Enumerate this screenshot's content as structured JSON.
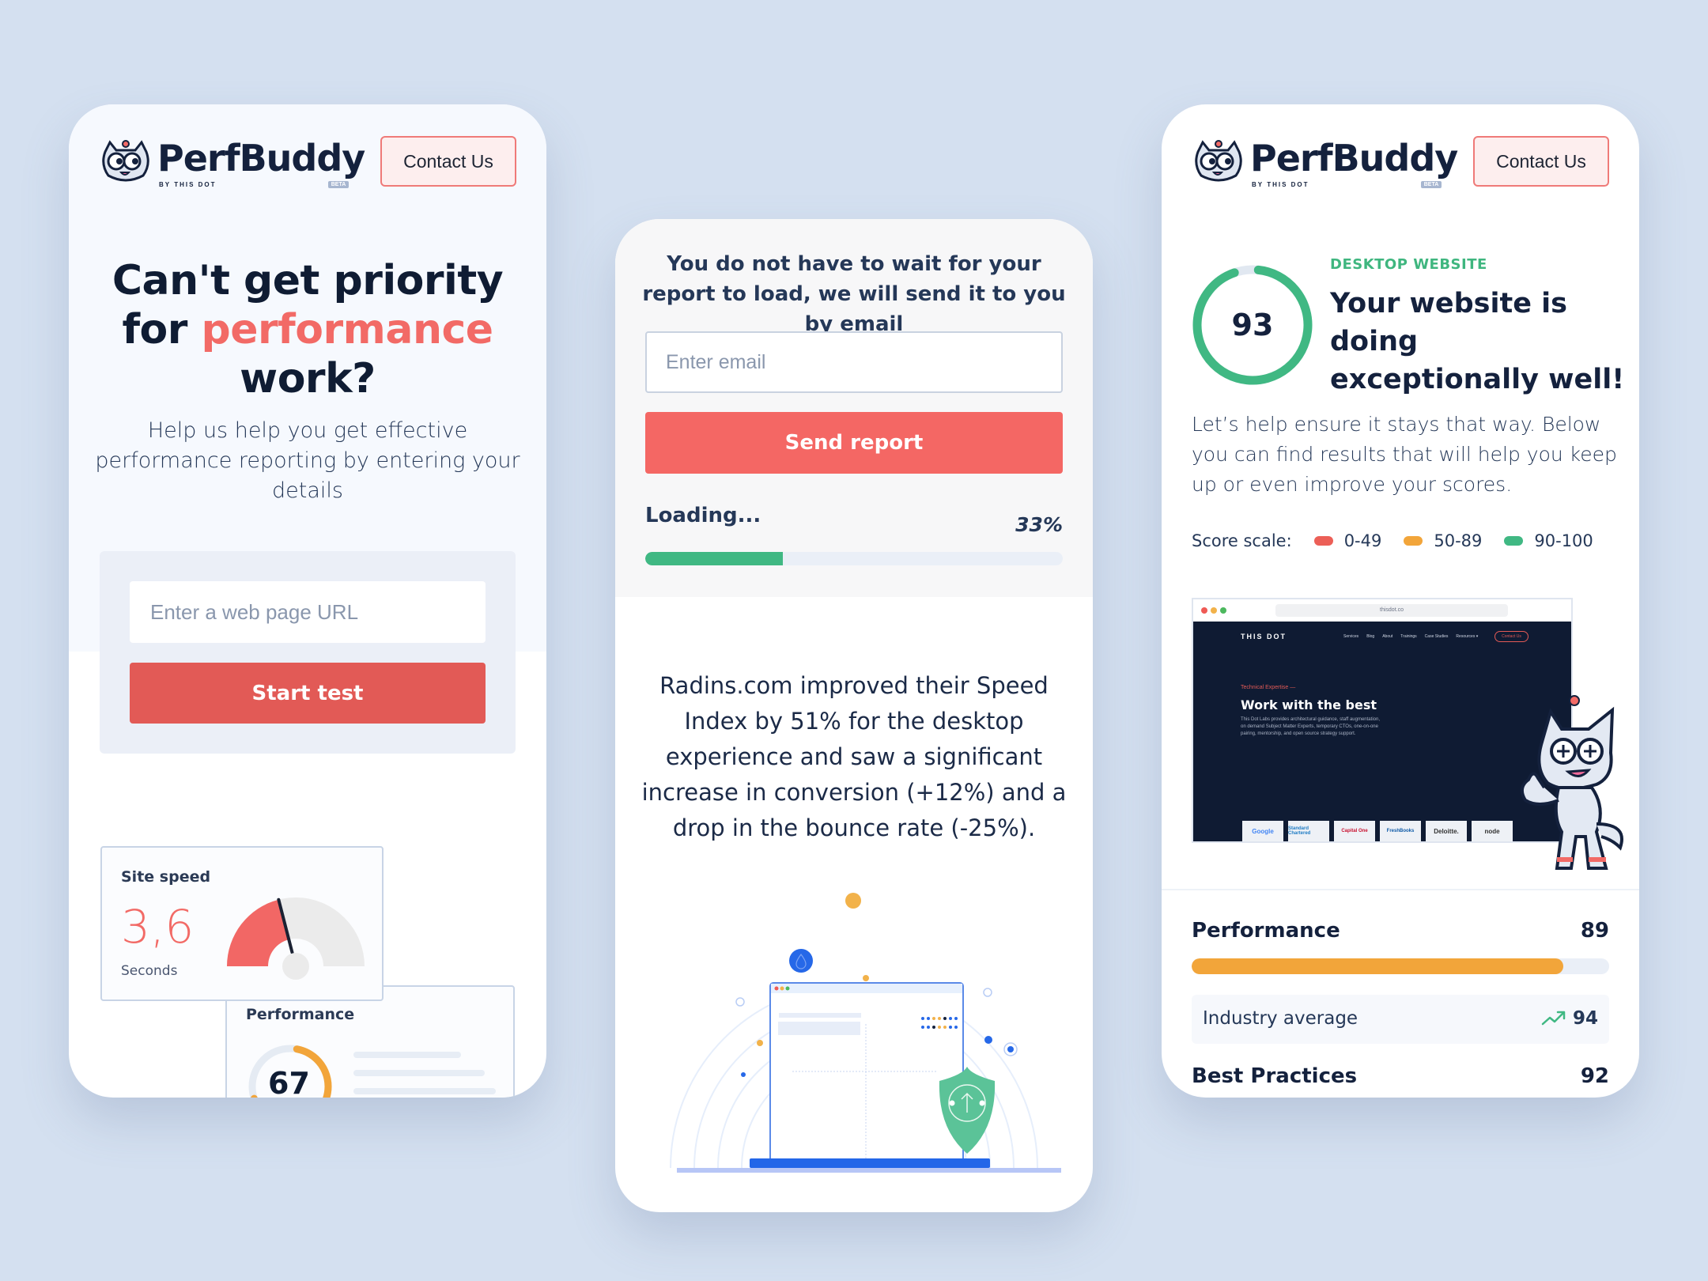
{
  "brand": {
    "name": "PerfBuddy",
    "byline": "BY THIS DOT",
    "badge": "BETA",
    "contact_label": "Contact Us"
  },
  "colors": {
    "background": "#d4e0f0",
    "accent_red": "#f26a66",
    "button_red": "#e25a56",
    "green": "#40b883",
    "orange": "#f2a53a",
    "navy": "#14213d"
  },
  "left": {
    "title_part1": "Can't get priority",
    "title_part2": "for ",
    "title_accent": "performance",
    "title_part3": "work?",
    "subtitle": "Help us help you get effective performance reporting by entering your details",
    "url_placeholder": "Enter a web page URL",
    "url_value": "",
    "start_label": "Start test",
    "site_speed": {
      "label": "Site speed",
      "value": "3,6",
      "unit": "Seconds",
      "gauge_fraction": 0.42
    },
    "performance_preview": {
      "label": "Performance",
      "score": "67",
      "fraction": 0.67
    }
  },
  "middle": {
    "note": "You do not have to wait for your report to load, we will send it to you by email",
    "email_placeholder": "Enter email",
    "email_value": "",
    "send_label": "Send report",
    "loading_label": "Loading...",
    "progress_text": "33%",
    "progress": 0.33,
    "case_study": "Radins.com improved their Speed Index by 51% for the desktop experience and saw a significant increase in conversion (+12%) and a drop in the bounce rate (-25%)."
  },
  "right": {
    "score": "93",
    "score_fraction": 0.93,
    "kicker": "DESKTOP WEBSITE",
    "title": "Your website is doing exceptionally well!",
    "description": "Let’s help ensure it stays that way. Below you can find results that will help you keep up or even improve your scores.",
    "scale_label": "Score scale:",
    "scale": [
      {
        "range": "0-49",
        "color": "#ec5f57"
      },
      {
        "range": "50-89",
        "color": "#f2a53a"
      },
      {
        "range": "90-100",
        "color": "#40b883"
      }
    ],
    "preview": {
      "url": "thisdot.co",
      "brand": "THIS DOT",
      "nav": [
        "Services",
        "Blog",
        "About",
        "Trainings",
        "Case Studies",
        "Resources ▾"
      ],
      "nav_contact": "Contact Us",
      "kicker": "Technical Expertise —",
      "title": "Work with the best",
      "description": "This Dot Labs provides architectural guidance, staff augmentation, on demand Subject Matter Experts, temporary CTOs, one-on-one pairing, mentorship, and open source strategy support.",
      "logos": [
        "Google",
        "Standard Chartered",
        "Capital One",
        "FreshBooks",
        "Deloitte.",
        "node"
      ]
    },
    "metrics": [
      {
        "label": "Performance",
        "value": "89",
        "fraction": 0.89
      },
      {
        "label": "Best Practices",
        "value": "92"
      }
    ],
    "industry": {
      "label": "Industry average",
      "value": "94",
      "trend": "up"
    }
  }
}
